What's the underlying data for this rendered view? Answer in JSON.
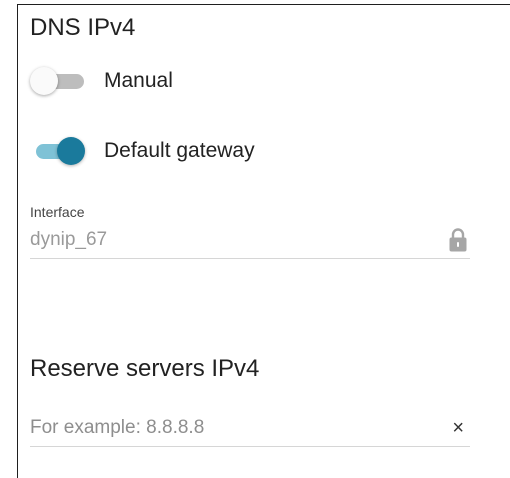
{
  "dns_ipv4": {
    "title": "DNS IPv4",
    "manual_toggle": {
      "label": "Manual",
      "on": false
    },
    "default_gateway_toggle": {
      "label": "Default gateway",
      "on": true
    },
    "interface_field": {
      "label": "Interface",
      "value": "dynip_67",
      "locked": true,
      "icon": "lock-icon"
    }
  },
  "reserve_servers_ipv4": {
    "title": "Reserve servers IPv4",
    "server_input": {
      "value": "",
      "placeholder": "For example: 8.8.8.8",
      "clear_symbol": "×"
    }
  },
  "colors": {
    "accent": "#1a7a9c",
    "accent_track": "#7fc2d6",
    "off_track": "#bdbdbd",
    "text": "#222222",
    "muted_text": "#9a9a9a",
    "divider": "#d6d6d6"
  }
}
